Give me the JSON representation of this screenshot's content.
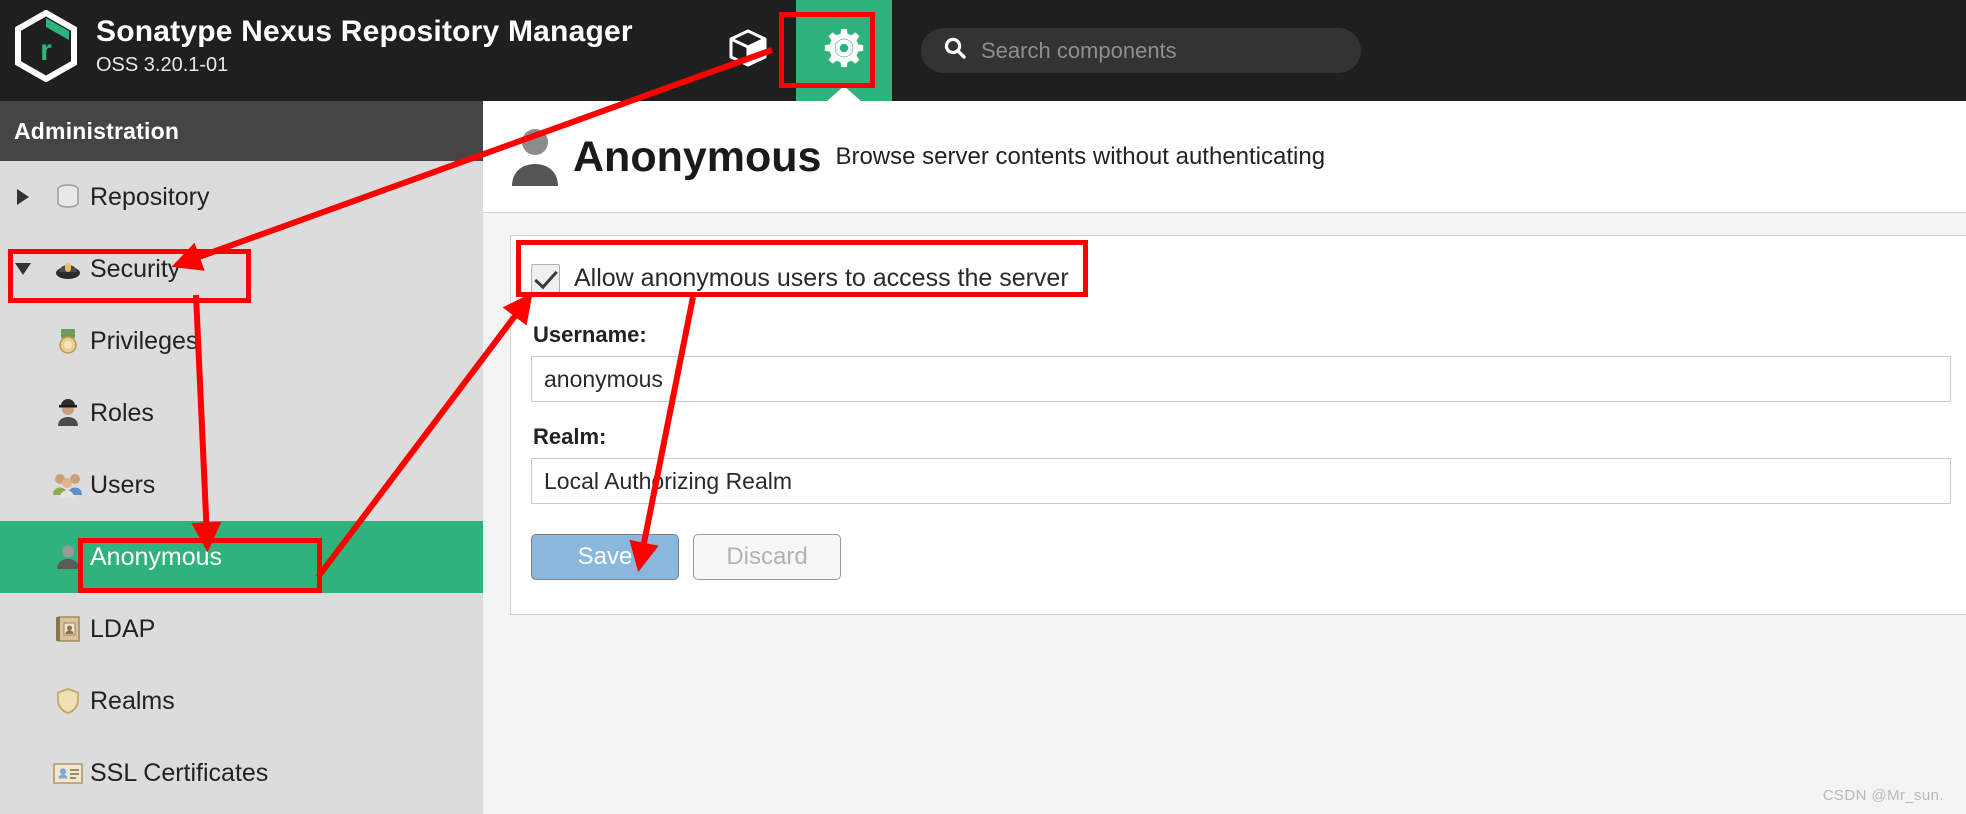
{
  "header": {
    "brand_title": "Sonatype Nexus Repository Manager",
    "brand_version": "OSS 3.20.1-01",
    "logo_icon": "nexus-hexagon-logo-icon",
    "browse_icon": "cube-box-icon",
    "admin_icon": "gear-icon",
    "search": {
      "icon": "search-icon",
      "placeholder": "Search components",
      "value": ""
    }
  },
  "sidebar": {
    "title": "Administration",
    "items": [
      {
        "label": "Repository",
        "icon": "database-icon",
        "twisty": "collapsed-right-triangle",
        "level": 1,
        "selected": false
      },
      {
        "label": "Security",
        "icon": "security-badge-icon",
        "twisty": "expanded-down-triangle",
        "level": 1,
        "selected": false
      },
      {
        "label": "Privileges",
        "icon": "medal-icon",
        "level": 2,
        "selected": false
      },
      {
        "label": "Roles",
        "icon": "police-officer-icon",
        "level": 2,
        "selected": false
      },
      {
        "label": "Users",
        "icon": "users-group-icon",
        "level": 2,
        "selected": false
      },
      {
        "label": "Anonymous",
        "icon": "anonymous-bust-icon",
        "level": 2,
        "selected": true
      },
      {
        "label": "LDAP",
        "icon": "address-book-icon",
        "level": 2,
        "selected": false
      },
      {
        "label": "Realms",
        "icon": "shield-icon",
        "level": 2,
        "selected": false
      },
      {
        "label": "SSL Certificates",
        "icon": "id-card-icon",
        "level": 2,
        "selected": false
      }
    ]
  },
  "page": {
    "icon": "anonymous-bust-icon",
    "title": "Anonymous",
    "description": "Browse server contents without authenticating"
  },
  "form": {
    "checkbox": {
      "label": "Allow anonymous users to access the server",
      "checked": true
    },
    "username": {
      "label": "Username:",
      "value": "anonymous"
    },
    "realm": {
      "label": "Realm:",
      "value": "Local Authorizing Realm"
    },
    "save_label": "Save",
    "discard_label": "Discard"
  },
  "watermark": "CSDN @Mr_sun.",
  "colors": {
    "accent_green": "#2fb27c",
    "topbar_dark": "#1f1f1f",
    "sidebar_bg": "#dcdcdc",
    "admin_header_bg": "#454545",
    "annotation_red": "#fe0000",
    "save_blue": "#8ab8dd"
  }
}
